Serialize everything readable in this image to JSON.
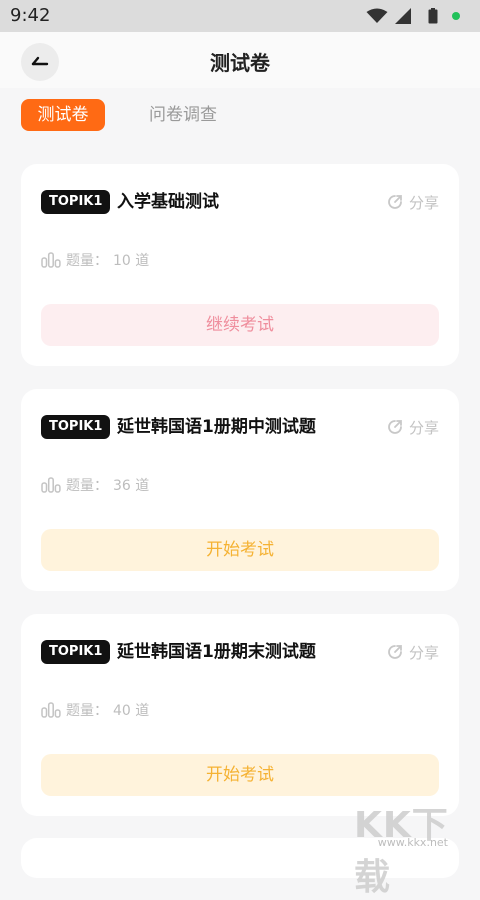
{
  "status_bar": {
    "time": "9:42"
  },
  "header": {
    "title": "测试卷"
  },
  "tabs": [
    {
      "label": "测试卷",
      "active": true
    },
    {
      "label": "问卷调查",
      "active": false
    }
  ],
  "cards": [
    {
      "level": "TOPIK1",
      "title": "入学基础测试",
      "share_label": "分享",
      "count_label": "题量：",
      "count_value": "10 道",
      "action_label": "继续考试"
    },
    {
      "level": "TOPIK1",
      "title": "延世韩国语1册期中测试题",
      "share_label": "分享",
      "count_label": "题量：",
      "count_value": "36 道",
      "action_label": "开始考试"
    },
    {
      "level": "TOPIK1",
      "title": "延世韩国语1册期末测试题",
      "share_label": "分享",
      "count_label": "题量：",
      "count_value": "40 道",
      "action_label": "开始考试"
    }
  ],
  "watermark": {
    "main": "KK下载",
    "url": "www.kkx.net"
  },
  "colors": {
    "accent": "#ff6a14",
    "continue_bg": "#fdeef0",
    "continue_text": "#ef8e9d",
    "start_bg": "#fff3dc",
    "start_text": "#f5b233"
  },
  "icons": {
    "back": "arrow-left-icon",
    "share": "share-icon",
    "count": "bar-chart-icon"
  }
}
